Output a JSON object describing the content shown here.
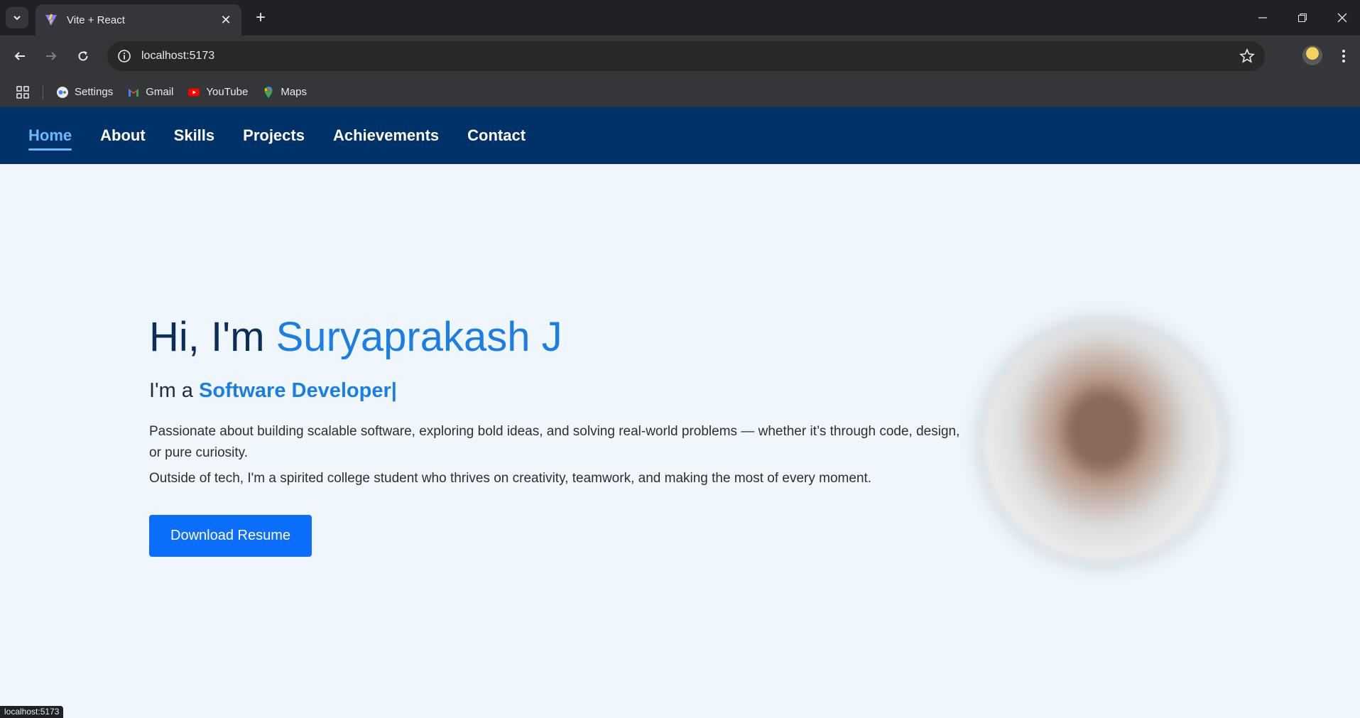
{
  "browser": {
    "tab_title": "Vite + React",
    "url": "localhost:5173",
    "bookmarks": [
      {
        "label": "Settings",
        "icon": "settings-icon"
      },
      {
        "label": "Gmail",
        "icon": "gmail-icon"
      },
      {
        "label": "YouTube",
        "icon": "youtube-icon"
      },
      {
        "label": "Maps",
        "icon": "maps-icon"
      }
    ],
    "status_url": "localhost:5173"
  },
  "nav": {
    "items": [
      "Home",
      "About",
      "Skills",
      "Projects",
      "Achievements",
      "Contact"
    ],
    "active": "Home"
  },
  "hero": {
    "greeting": "Hi, I'm ",
    "name": "Suryaprakash J",
    "role_prefix": "I'm a ",
    "role": "Software Developer|",
    "paragraph1": "Passionate about building scalable software, exploring bold ideas, and solving real-world problems — whether it’s through code, design, or pure curiosity.",
    "paragraph2": "Outside of tech, I'm a spirited college student who thrives on creativity, teamwork, and making the most of every moment.",
    "button": "Download Resume"
  },
  "colors": {
    "nav_bg": "#003168",
    "accent": "#1a7ee6",
    "button": "#0b6efd",
    "page_bg": "#eff7fd"
  }
}
